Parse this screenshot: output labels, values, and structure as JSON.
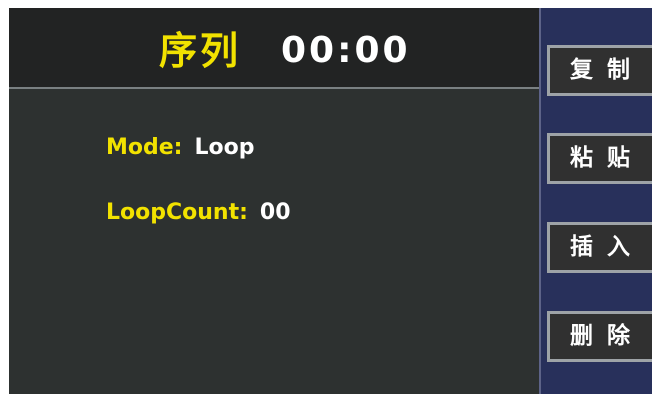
{
  "header": {
    "title": "序列",
    "time": "00:00"
  },
  "fields": {
    "mode_label": "Mode:",
    "mode_value": "Loop",
    "loopcount_label": "LoopCount:",
    "loopcount_value": "00"
  },
  "sidebar": {
    "buttons": [
      {
        "label": "复制"
      },
      {
        "label": "粘贴"
      },
      {
        "label": "插入"
      },
      {
        "label": "删除"
      }
    ]
  },
  "colors": {
    "label_yellow": "#f2e200",
    "panel_dark": "#2d3130",
    "sidebar_navy": "#28305b"
  }
}
